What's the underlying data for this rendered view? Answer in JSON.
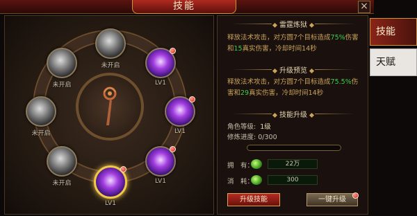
{
  "window": {
    "title": "技能",
    "close_icon": "×"
  },
  "wheel": {
    "nodes": [
      {
        "id": "top",
        "label": "未开启",
        "state": "locked"
      },
      {
        "id": "upper-left",
        "label": "未开启",
        "state": "locked"
      },
      {
        "id": "upper-right",
        "label": "LV1",
        "state": "active"
      },
      {
        "id": "left",
        "label": "未开启",
        "state": "locked"
      },
      {
        "id": "right",
        "label": "LV1",
        "state": "active"
      },
      {
        "id": "lower-left",
        "label": "未开启",
        "state": "locked"
      },
      {
        "id": "lower-right",
        "label": "LV1",
        "state": "active"
      },
      {
        "id": "bottom",
        "label": "LV1",
        "state": "selected"
      }
    ]
  },
  "info": {
    "skill_name": "雷霆炼狱",
    "current_desc_a": "释放法术攻击，对方圆7个目标造成",
    "current_pct": "75%",
    "current_desc_b": "伤害和",
    "current_true": "15",
    "current_desc_c": "真实伤害，冷却时间14秒",
    "preview_title": "升级预览",
    "preview_desc_a": "释放法术攻击，对方圆7个目标造成",
    "preview_pct": "75.5%",
    "preview_desc_b": "伤害和",
    "preview_true": "29",
    "preview_desc_c": "真实伤害，冷却时间14秒",
    "upgrade_title": "技能升级",
    "role_level_label": "角色等级:",
    "role_level_value": "1级",
    "progress_label": "修炼进度:",
    "progress_value": "0/300",
    "progress_fraction": 0,
    "own_label": "拥　有：",
    "own_value": "22万",
    "cost_label": "消　耗：",
    "cost_value": "300",
    "upgrade_button": "升级技能",
    "oneclick_button": "一键升级"
  },
  "tabs": [
    {
      "label": "技能",
      "active": true
    },
    {
      "label": "天赋",
      "active": false
    }
  ],
  "colors": {
    "accent_red": "#b62a20",
    "gold": "#c9a35a",
    "green_text": "#39d24a"
  }
}
